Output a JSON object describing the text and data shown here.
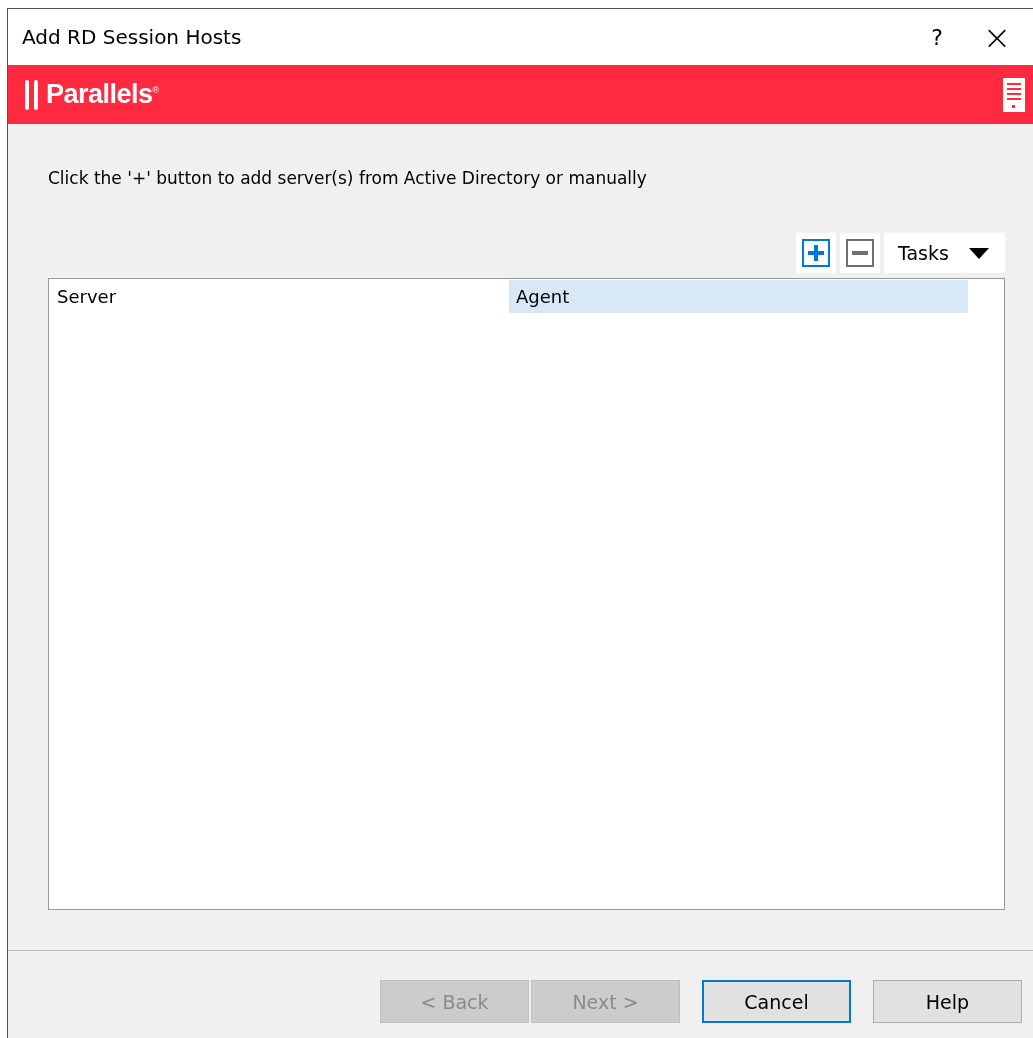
{
  "window": {
    "title": "Add RD Session Hosts",
    "help": "?",
    "close": "×"
  },
  "banner": {
    "brand": "Parallels$^{®}$"
  },
  "instruction": "Click the '+' button to add server(s) from Active Directory or manually",
  "toolbar": {
    "tasks": "Tasks"
  },
  "table": {
    "columns": [
      {
        "label": "Server",
        "selected": false
      },
      {
        "label": "Agent",
        "selected": true
      }
    ]
  },
  "buttons": [
    {
      "label": "< Back",
      "disabled": true,
      "default": false
    },
    {
      "label": "Next >",
      "disabled": true,
      "default": false
    },
    {
      "label": "Cancel",
      "disabled": false,
      "default": true
    },
    {
      "label": "Help",
      "disabled": false,
      "default": false
    }
  ]
}
